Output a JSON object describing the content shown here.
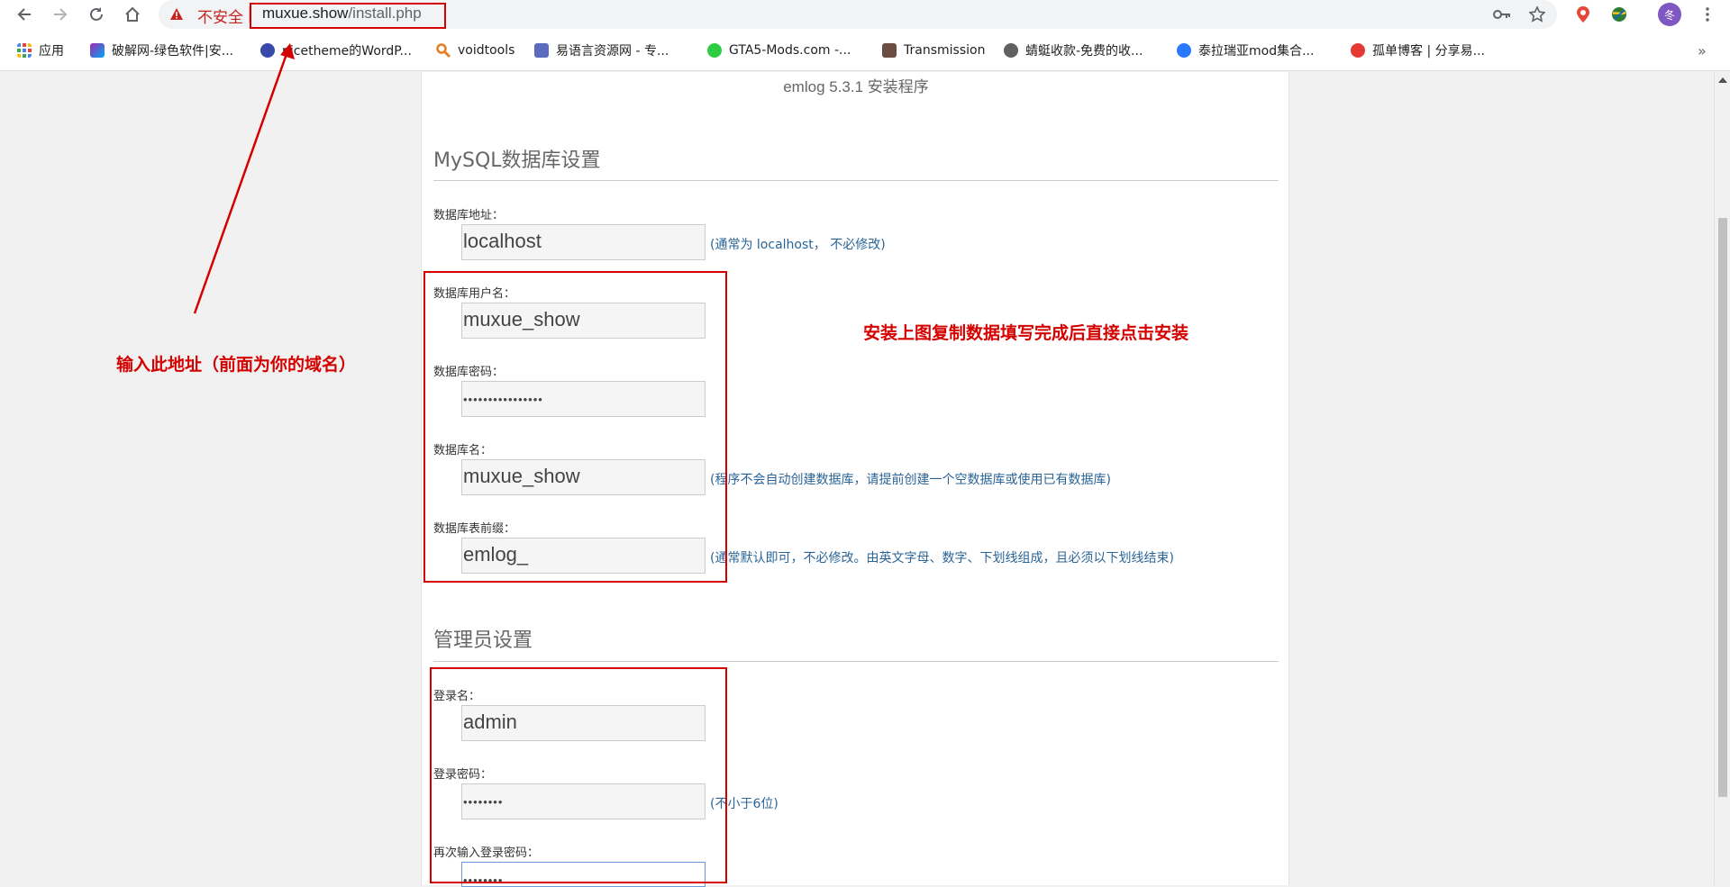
{
  "browser": {
    "security_label": "不安全",
    "url_host": "muxue.show",
    "url_path": "/install.php",
    "profile_initial": "冬",
    "bookmarks": [
      {
        "label": "应用",
        "icon": "apps-grid-icon"
      },
      {
        "label": "破解网-绿色软件|安...",
        "icon": "pojie-site-icon"
      },
      {
        "label": "nicetheme的WordP...",
        "icon": "nicetheme-icon"
      },
      {
        "label": "voidtools",
        "icon": "voidtools-icon"
      },
      {
        "label": "易语言资源网 - 专...",
        "icon": "yiyuyan-icon"
      },
      {
        "label": "GTA5-Mods.com -...",
        "icon": "gta5mods-icon"
      },
      {
        "label": "Transmission",
        "icon": "transmission-icon"
      },
      {
        "label": "蜻蜓收款-免费的收...",
        "icon": "globe-icon"
      },
      {
        "label": "泰拉瑞亚mod集合...",
        "icon": "baidu-paw-icon"
      },
      {
        "label": "孤单博客 | 分享易...",
        "icon": "angry-bird-icon"
      }
    ],
    "more_bookmarks": "»"
  },
  "install": {
    "title": "emlog 5.3.1 安装程序",
    "mysql_section": "MySQL数据库设置",
    "admin_section": "管理员设置",
    "db_host": {
      "label": "数据库地址：",
      "value": "localhost",
      "hint": "(通常为 localhost， 不必修改)"
    },
    "db_user": {
      "label": "数据库用户名：",
      "value": "muxue_show"
    },
    "db_pass": {
      "label": "数据库密码：",
      "value": "••••••••••••••••"
    },
    "db_name": {
      "label": "数据库名：",
      "value": "muxue_show",
      "hint": "(程序不会自动创建数据库，请提前创建一个空数据库或使用已有数据库)"
    },
    "db_prefix": {
      "label": "数据库表前缀：",
      "value": "emlog_",
      "hint": "(通常默认即可，不必修改。由英文字母、数字、下划线组成，且必须以下划线结束)"
    },
    "admin_user": {
      "label": "登录名：",
      "value": "admin"
    },
    "admin_pass": {
      "label": "登录密码：",
      "value": "••••••••",
      "hint": "(不小于6位)"
    },
    "admin_pass2": {
      "label": "再次输入登录密码：",
      "value": "••••••••"
    }
  },
  "annotations": {
    "left_note": "输入此地址（前面为你的域名）",
    "right_note": "安装上图复制数据填写完成后直接点击安装"
  },
  "colors": {
    "annotation_red": "#d40000",
    "hint_blue": "#2a6496",
    "security_red": "#c5221f"
  }
}
